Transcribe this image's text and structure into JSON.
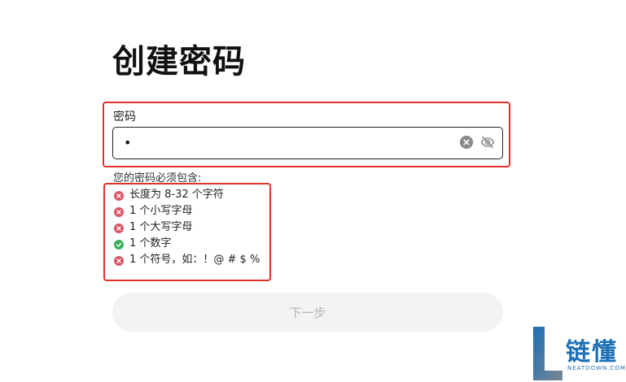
{
  "header": {
    "title": "创建密码"
  },
  "password_field": {
    "label": "密码",
    "masked_value": "•",
    "clear_icon": "clear-circle-icon",
    "visibility_icon": "eye-off-icon"
  },
  "requirements": {
    "intro": "您的密码必须包含:",
    "items": [
      {
        "label": "长度为 8-32 个字符",
        "status": "unmet",
        "icon": "x-circle-icon"
      },
      {
        "label": "1 个小写字母",
        "status": "unmet",
        "icon": "x-circle-icon"
      },
      {
        "label": "1 个大写字母",
        "status": "unmet",
        "icon": "x-circle-icon"
      },
      {
        "label": "1 个数字",
        "status": "met",
        "icon": "check-circle-icon"
      },
      {
        "label": "1 个符号，如：！@ # $ %",
        "status": "unmet",
        "icon": "x-circle-icon"
      }
    ]
  },
  "actions": {
    "next_label": "下一步",
    "next_enabled": false
  },
  "watermark": {
    "name": "链懂",
    "domain": "NEATDOWN.COM"
  },
  "colors": {
    "annotation": "#e0322b",
    "unmet": "#d9556a",
    "met": "#3cae5c",
    "button_bg": "#f3f3f3",
    "button_text": "#b4b4b4",
    "brand": "#1e6fb5"
  }
}
